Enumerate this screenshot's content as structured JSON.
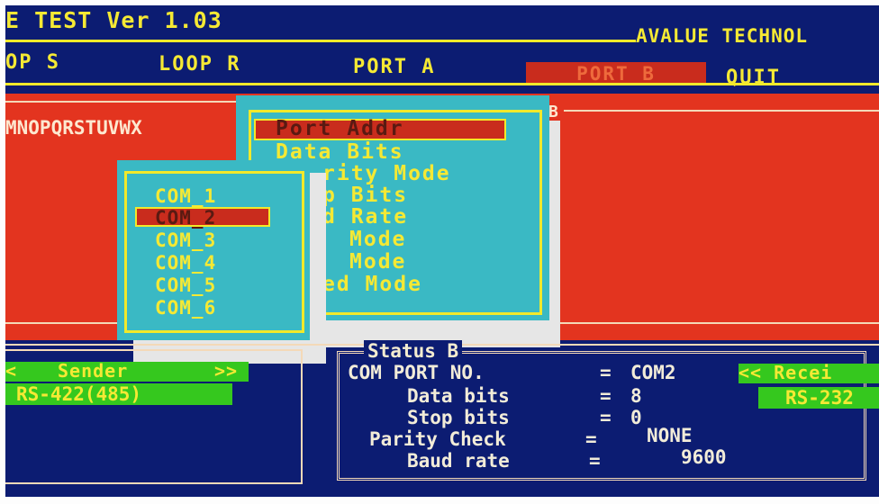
{
  "app": {
    "title": "E TEST Ver 1.03",
    "brand": "AVALUE TECHNOL"
  },
  "menubar": {
    "items": [
      {
        "id": "loop-s",
        "label": "OP S"
      },
      {
        "id": "loop-r",
        "label": "LOOP R"
      },
      {
        "id": "port-a",
        "label": "PORT A"
      },
      {
        "id": "port-b",
        "label": "PORT B",
        "selected": true
      },
      {
        "id": "quit",
        "label": "QUIT"
      }
    ]
  },
  "data_panel": {
    "text": "MNOPQRSTUVWX",
    "corner_label": "B"
  },
  "port_menu": {
    "items": [
      {
        "label": "Port Addr",
        "selected": true
      },
      {
        "label": "Data Bits"
      },
      {
        "label": "rity Mode"
      },
      {
        "label": "p Bits"
      },
      {
        "label": "d Rate"
      },
      {
        "label": "Mode"
      },
      {
        "label": "Mode"
      },
      {
        "label": "ed Mode"
      }
    ]
  },
  "com_menu": {
    "items": [
      {
        "label": "COM_1"
      },
      {
        "label": "COM_2",
        "selected": true
      },
      {
        "label": "COM_3"
      },
      {
        "label": "COM_4"
      },
      {
        "label": "COM_5"
      },
      {
        "label": "COM_6"
      }
    ]
  },
  "sender": {
    "header_left": "<",
    "header_label": "Sender",
    "header_right": ">>",
    "mode": "RS-422(485)"
  },
  "status": {
    "title": "Status B",
    "rows": [
      {
        "label": "COM PORT NO.",
        "value": "COM2"
      },
      {
        "label": "Data bits",
        "value": "8"
      },
      {
        "label": "Stop bits",
        "value": "0"
      },
      {
        "label": "Parity Check",
        "value": "NONE"
      },
      {
        "label": "Baud rate",
        "value": "9600"
      }
    ]
  },
  "receiver": {
    "header": "<< Recei",
    "mode": "RS-232"
  },
  "colors": {
    "background_blue": "#0c1c72",
    "text_yellow": "#f5e934",
    "panel_red": "#e3341f",
    "menu_cyan": "#3ab9c4",
    "highlight_red": "#c92c1d",
    "label_green": "#35c81e"
  }
}
